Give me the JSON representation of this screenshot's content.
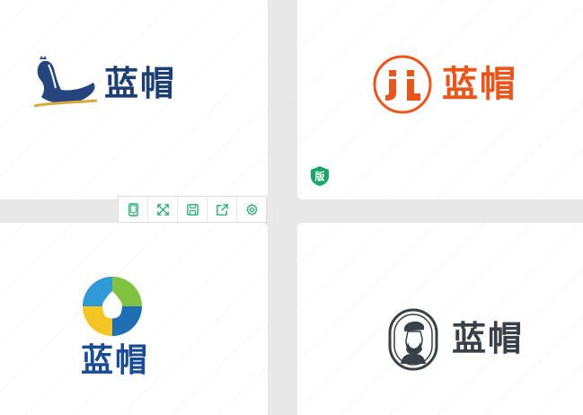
{
  "logos": [
    {
      "brand_text": "蓝帽"
    },
    {
      "brand_text": "蓝帽"
    },
    {
      "brand_text": "蓝帽"
    },
    {
      "brand_text": "蓝帽"
    }
  ],
  "badge": {
    "label": "版"
  },
  "colors": {
    "navy": "#1c3f73",
    "orange": "#e8561b",
    "blue": "#1a4c93",
    "charcoal": "#3a4048",
    "accent_green": "#1aa56b"
  },
  "toolbar": {
    "tools": [
      {
        "icon": "mobile-icon"
      },
      {
        "icon": "expand-icon"
      },
      {
        "icon": "save-icon"
      },
      {
        "icon": "share-icon"
      },
      {
        "icon": "gear-icon"
      }
    ]
  }
}
